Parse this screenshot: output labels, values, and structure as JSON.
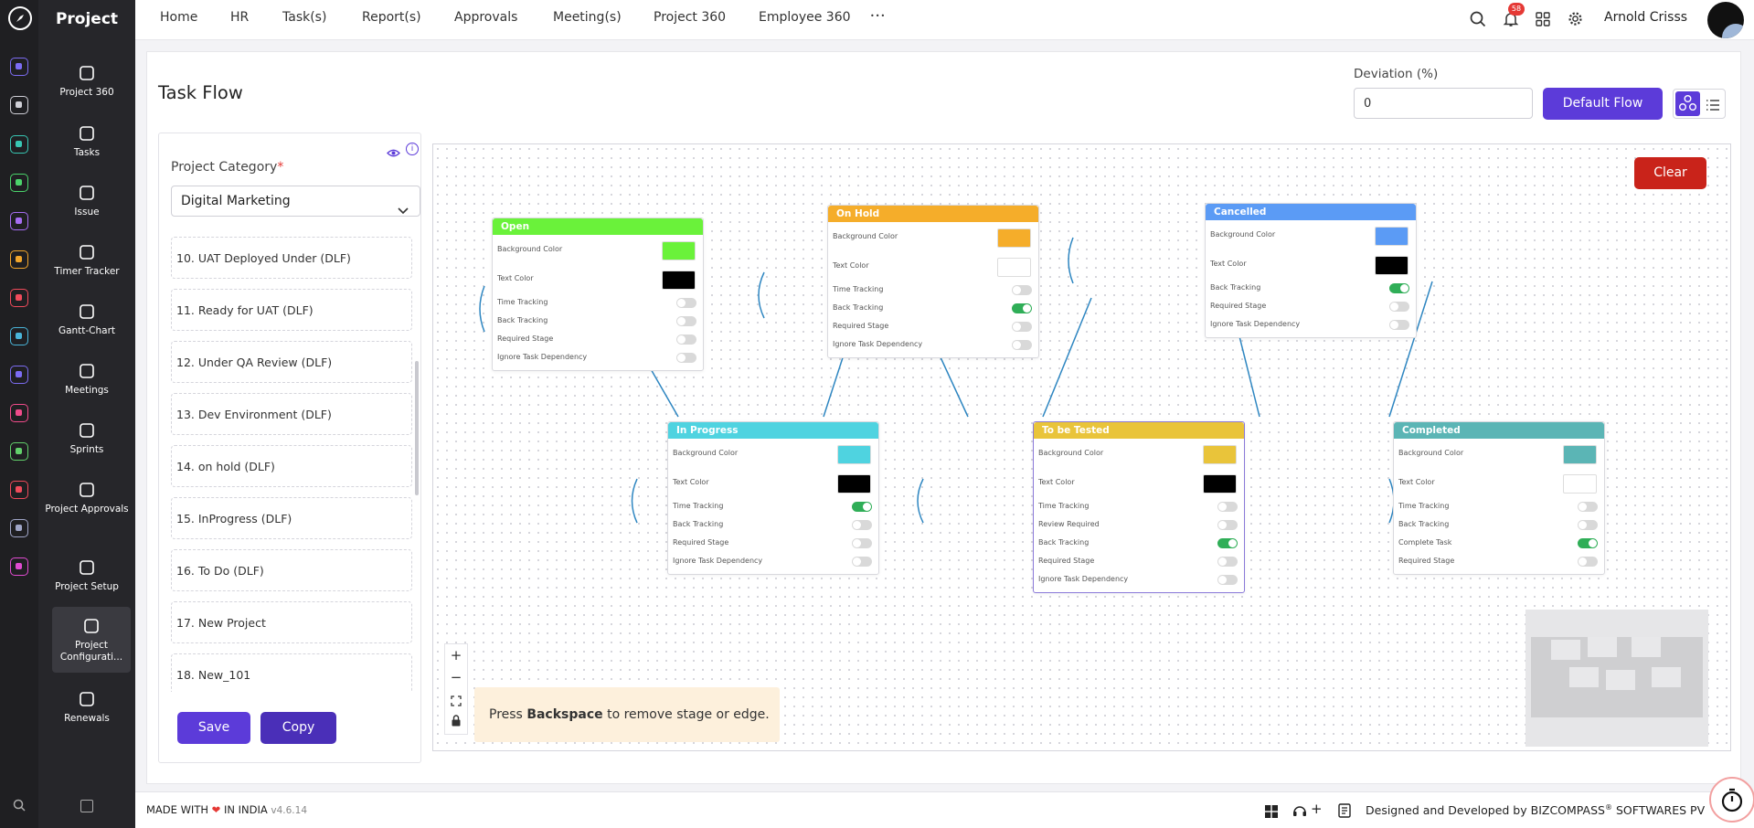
{
  "app": {
    "name": "Project",
    "version": "v4.6.14"
  },
  "rail_colors": [
    "#7c6cf2",
    "#cfcfd6",
    "#38c7b3",
    "#4bd46b",
    "#a66df2",
    "#f2a62b",
    "#f04b5b",
    "#4ab5d9",
    "#7c6cf2",
    "#f04b8a",
    "#62d06b",
    "#f04b5b",
    "#a0a6c8",
    "#e04bd0"
  ],
  "sidebar": {
    "items": [
      {
        "label": "Project 360",
        "icon": "briefcase-icon"
      },
      {
        "label": "Tasks",
        "icon": "clipboard-icon"
      },
      {
        "label": "Issue",
        "icon": "alert-icon"
      },
      {
        "label": "Timer Tracker",
        "icon": "alarm-icon"
      },
      {
        "label": "Gantt-Chart",
        "icon": "gantt-icon"
      },
      {
        "label": "Meetings",
        "icon": "meeting-icon"
      },
      {
        "label": "Sprints",
        "icon": "gear-icon"
      },
      {
        "label": "Project Approvals",
        "icon": "user-check-icon"
      },
      {
        "label": "Project Setup",
        "icon": "gear-icon"
      },
      {
        "label": "Project Configurati...",
        "icon": "gear-icon"
      },
      {
        "label": "Renewals",
        "icon": "refresh-icon"
      }
    ]
  },
  "topnav": {
    "items": [
      "Home",
      "HR",
      "Task(s)",
      "Report(s)",
      "Approvals",
      "Meeting(s)",
      "Project 360",
      "Employee 360"
    ],
    "more": "•••",
    "notification_count": "58",
    "user_name": "Arnold Crisss"
  },
  "page": {
    "title": "Task Flow",
    "deviation_label": "Deviation (%)",
    "deviation_value": "0",
    "default_flow_label": "Default Flow",
    "clear_label": "Clear"
  },
  "left_panel": {
    "category_label": "Project Category",
    "required_mark": "*",
    "category_value": "Digital Marketing",
    "list": [
      "10. UAT Deployed Under (DLF)",
      "11. Ready for UAT (DLF)",
      "12. Under QA Review (DLF)",
      "13. Dev Environment (DLF)",
      "14. on hold (DLF)",
      "15. InProgress (DLF)",
      "16. To Do (DLF)",
      "17. New Project",
      "18. New_101"
    ],
    "save_label": "Save",
    "copy_label": "Copy"
  },
  "labels": {
    "background_color": "Background Color",
    "text_color": "Text Color"
  },
  "stages": [
    {
      "name": "Open",
      "header": "#6af23a",
      "bg": "#6af23a",
      "text": "#000000",
      "toggles": [
        [
          "Time Tracking",
          false
        ],
        [
          "Back Tracking",
          false
        ],
        [
          "Required Stage",
          false
        ],
        [
          "Ignore Task Dependency",
          false
        ]
      ]
    },
    {
      "name": "On Hold",
      "header": "#f5ad2a",
      "bg": "#f5ad2a",
      "text": "#ffffff",
      "toggles": [
        [
          "Time Tracking",
          false
        ],
        [
          "Back Tracking",
          true
        ],
        [
          "Required Stage",
          false
        ],
        [
          "Ignore Task Dependency",
          false
        ]
      ]
    },
    {
      "name": "Cancelled",
      "header": "#5b9bf5",
      "bg": "#5b9bf5",
      "text": "#000000",
      "toggles": [
        [
          "Back Tracking",
          true
        ],
        [
          "Required Stage",
          false
        ],
        [
          "Ignore Task Dependency",
          false
        ]
      ]
    },
    {
      "name": "In Progress",
      "header": "#4fd3e0",
      "bg": "#4fd3e0",
      "text": "#000000",
      "toggles": [
        [
          "Time Tracking",
          true
        ],
        [
          "Back Tracking",
          false
        ],
        [
          "Required Stage",
          false
        ],
        [
          "Ignore Task Dependency",
          false
        ]
      ]
    },
    {
      "name": "To be Tested",
      "header": "#e9c43a",
      "bg": "#e9c43a",
      "text": "#000000",
      "toggles": [
        [
          "Time Tracking",
          false
        ],
        [
          "Review Required",
          false
        ],
        [
          "Back Tracking",
          true
        ],
        [
          "Required Stage",
          false
        ],
        [
          "Ignore Task Dependency",
          false
        ]
      ]
    },
    {
      "name": "Completed",
      "header": "#5bb5b5",
      "bg": "#5bb5b5",
      "text": "#ffffff",
      "toggles": [
        [
          "Time Tracking",
          false
        ],
        [
          "Back Tracking",
          false
        ],
        [
          "Complete Task",
          true
        ],
        [
          "Required Stage",
          false
        ]
      ]
    }
  ],
  "hint": {
    "pre": "Press",
    "key": "Backspace",
    "post": "to remove stage or edge."
  },
  "footer": {
    "made_with": "MADE WITH",
    "in_india": "IN INDIA",
    "designed": "Designed and Developed by",
    "company": "BIZCOMPASS",
    "reg": "®",
    "company_rest": "SOFTWARES PV"
  }
}
